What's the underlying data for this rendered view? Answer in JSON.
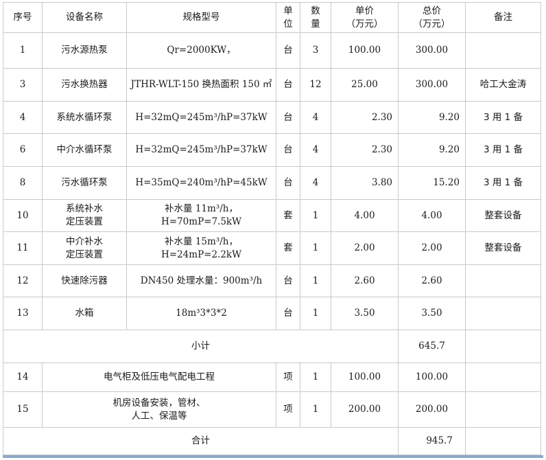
{
  "headers": {
    "seq": "序号",
    "name": "设备名称",
    "spec": "规格型号",
    "unit_l1": "单",
    "unit_l2": "位",
    "qty_l1": "数",
    "qty_l2": "量",
    "price_l1": "单价",
    "price_l2": "（万元）",
    "total_l1": "总价",
    "total_l2": "（万元）",
    "note": "备注"
  },
  "rows": [
    {
      "seq": "1",
      "name": "污水源热泵",
      "spec": "Qr=2000KW，",
      "unit": "台",
      "qty": "3",
      "price": "100.00",
      "total": "300.00",
      "note": ""
    },
    {
      "seq": "3",
      "name": "污水换热器",
      "spec": "JTHR-WLT-150 换热面积 150 ㎡",
      "unit": "台",
      "qty": "12",
      "price": "25.00",
      "total": "300.00",
      "note": "哈工大金涛"
    },
    {
      "seq": "4",
      "name": "系统水循环泵",
      "spec": "H=32mQ=245m³/hP=37kW",
      "unit": "台",
      "qty": "4",
      "price": "2.30",
      "total": "9.20",
      "note": "3 用 1 备"
    },
    {
      "seq": "6",
      "name": "中介水循环泵",
      "spec": "H=32mQ=245m³/hP=37kW",
      "unit": "台",
      "qty": "4",
      "price": "2.30",
      "total": "9.20",
      "note": "3 用 1 备"
    },
    {
      "seq": "8",
      "name": "污水循环泵",
      "spec": "H=35mQ=240m³/hP=45kW",
      "unit": "台",
      "qty": "4",
      "price": "3.80",
      "total": "15.20",
      "note": "3 用 1 备"
    },
    {
      "seq": "10",
      "name_l1": "系统补水",
      "name_l2": "定压装置",
      "spec_l1": "补水量 11m³/h，",
      "spec_l2": "H=70mP=7.5kW",
      "unit": "套",
      "qty": "1",
      "price": "4.00",
      "total": "4.00",
      "note": "整套设备"
    },
    {
      "seq": "11",
      "name_l1": "中介补水",
      "name_l2": "定压装置",
      "spec_l1": "补水量 15m³/h，",
      "spec_l2": "H=24mP=2.2kW",
      "unit": "套",
      "qty": "1",
      "price": "2.00",
      "total": "2.00",
      "note": "整套设备"
    },
    {
      "seq": "12",
      "name": "快速除污器",
      "spec": "DN450 处理水量：900m³/h",
      "unit": "台",
      "qty": "1",
      "price": "2.60",
      "total": "2.60",
      "note": ""
    },
    {
      "seq": "13",
      "name": "水箱",
      "spec": "18m³3*3*2",
      "unit": "台",
      "qty": "1",
      "price": "3.50",
      "total": "3.50",
      "note": ""
    }
  ],
  "subtotal": {
    "label": "小计",
    "value": "645.7"
  },
  "rows2": [
    {
      "seq": "14",
      "name": "电气柜及低压电气配电工程",
      "unit": "项",
      "qty": "1",
      "price": "100.00",
      "total": "100.00",
      "note": ""
    },
    {
      "seq": "15",
      "name_l1": "机房设备安装，管材、",
      "name_l2": "人工、保温等",
      "unit": "项",
      "qty": "1",
      "price": "200.00",
      "total": "200.00",
      "note": ""
    }
  ],
  "grand_total": {
    "label": "合计",
    "value": "945.7"
  }
}
